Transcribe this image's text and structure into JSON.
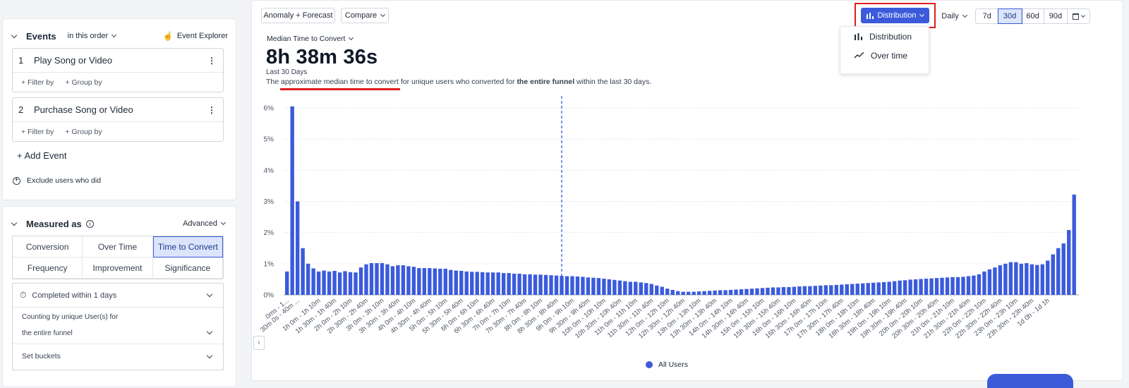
{
  "events_panel": {
    "title": "Events",
    "order": "in this order",
    "explorer": "Event Explorer",
    "events": [
      {
        "num": "1",
        "name": "Play Song or Video",
        "filter": "+ Filter by",
        "group": "+ Group by"
      },
      {
        "num": "2",
        "name": "Purchase Song or Video",
        "filter": "+ Filter by",
        "group": "+ Group by"
      }
    ],
    "add_event": "+ Add Event",
    "exclude": "Exclude users who did"
  },
  "measured_panel": {
    "title": "Measured as",
    "advanced": "Advanced",
    "options": [
      "Conversion",
      "Over Time",
      "Time to Convert",
      "Frequency",
      "Improvement",
      "Significance"
    ],
    "active": "Time to Convert",
    "completed": "Completed within 1 days",
    "counting": "Counting by unique User(s) for",
    "funnel": "the entire funnel",
    "buckets": "Set buckets"
  },
  "toolbar": {
    "anomaly": "Anomaly + Forecast",
    "compare": "Compare",
    "distribution": "Distribution",
    "interval": "Daily",
    "ranges": [
      "7d",
      "30d",
      "60d",
      "90d"
    ],
    "selected_range": "30d"
  },
  "dropdown": {
    "items": [
      {
        "label": "Distribution",
        "icon": "bar-chart-icon"
      },
      {
        "label": "Over time",
        "icon": "line-chart-icon"
      }
    ]
  },
  "metric": {
    "label": "Median Time to Convert",
    "value": "8h 38m 36s",
    "period": "Last 30 Days",
    "desc_1": "The approximate median time to convert for unique users who converted for",
    "desc_bold": "the entire funnel",
    "desc_2": "within the last 30 days."
  },
  "chart_data": {
    "type": "bar",
    "title": "",
    "ylabel": "",
    "xlabel": "",
    "ylim": [
      0,
      6.2
    ],
    "yticks": [
      "0%",
      "1%",
      "2%",
      "3%",
      "4%",
      "5%",
      "6%"
    ],
    "median_marker": "8h 30m - 8h 40m",
    "legend": "All Users",
    "series_color": "#3b5bdb",
    "x_tick_labels": [
      "0ms - 1...",
      "30m 0s - 40m ...",
      "1h 0m - 1h 10m",
      "1h 30m - 1h 40m",
      "2h 0m - 2h 10m",
      "2h 30m - 2h 40m",
      "3h 0m - 3h 10m",
      "3h 30m - 3h 40m",
      "4h 0m - 4h 10m",
      "4h 30m - 4h 40m",
      "5h 0m - 5h 10m",
      "5h 30m - 5h 40m",
      "6h 0m - 6h 10m",
      "6h 30m - 6h 40m",
      "7h 0m - 7h 10m",
      "7h 30m - 7h 40m",
      "8h 0m - 8h 10m",
      "8h 30m - 8h 40m",
      "9h 0m - 9h 10m",
      "9h 30m - 9h 40m",
      "10h 0m - 10h 10m",
      "10h 30m - 10h 40m",
      "11h 0m - 11h 10m",
      "11h 30m - 11h 40m",
      "12h 0m - 12h 10m",
      "12h 30m - 12h 40m",
      "13h 0m - 13h 10m",
      "13h 30m - 13h 40m",
      "14h 0m - 14h 10m",
      "14h 30m - 14h 40m",
      "15h 0m - 15h 10m",
      "15h 30m - 15h 40m",
      "16h 0m - 16h 10m",
      "16h 30m - 16h 40m",
      "17h 0m - 17h 10m",
      "17h 30m - 17h 40m",
      "18h 0m - 18h 10m",
      "18h 30m - 18h 40m",
      "19h 0m - 19h 10m",
      "19h 30m - 19h 40m",
      "20h 0m - 20h 10m",
      "20h 30m - 20h 40m",
      "21h 0m - 21h 10m",
      "21h 30m - 21h 40m",
      "22h 0m - 22h 10m",
      "22h 30m - 22h 40m",
      "23h 0m - 23h 10m",
      "23h 30m - 23h 40m",
      "1d 0h - 1d 1h"
    ],
    "values": [
      0.75,
      6.05,
      3.0,
      1.5,
      1.0,
      0.85,
      0.75,
      0.78,
      0.75,
      0.77,
      0.72,
      0.76,
      0.73,
      0.72,
      0.88,
      0.98,
      1.02,
      1.02,
      1.02,
      0.98,
      0.92,
      0.95,
      0.95,
      0.92,
      0.9,
      0.86,
      0.86,
      0.86,
      0.85,
      0.84,
      0.84,
      0.8,
      0.78,
      0.77,
      0.75,
      0.74,
      0.74,
      0.73,
      0.72,
      0.72,
      0.72,
      0.7,
      0.7,
      0.68,
      0.68,
      0.66,
      0.66,
      0.65,
      0.65,
      0.64,
      0.63,
      0.62,
      0.61,
      0.6,
      0.6,
      0.59,
      0.58,
      0.56,
      0.55,
      0.54,
      0.52,
      0.5,
      0.48,
      0.46,
      0.44,
      0.42,
      0.42,
      0.4,
      0.38,
      0.35,
      0.3,
      0.26,
      0.2,
      0.16,
      0.12,
      0.1,
      0.1,
      0.1,
      0.11,
      0.12,
      0.13,
      0.14,
      0.15,
      0.15,
      0.16,
      0.17,
      0.18,
      0.19,
      0.2,
      0.21,
      0.22,
      0.23,
      0.24,
      0.24,
      0.25,
      0.25,
      0.26,
      0.27,
      0.28,
      0.28,
      0.29,
      0.3,
      0.31,
      0.31,
      0.32,
      0.33,
      0.34,
      0.35,
      0.36,
      0.37,
      0.38,
      0.39,
      0.4,
      0.41,
      0.42,
      0.44,
      0.46,
      0.47,
      0.49,
      0.5,
      0.51,
      0.52,
      0.53,
      0.54,
      0.55,
      0.56,
      0.57,
      0.57,
      0.58,
      0.6,
      0.62,
      0.66,
      0.75,
      0.82,
      0.88,
      0.95,
      1.0,
      1.05,
      1.05,
      1.0,
      1.02,
      0.98,
      0.96,
      0.98,
      1.1,
      1.3,
      1.5,
      1.65,
      2.08,
      3.22
    ]
  }
}
